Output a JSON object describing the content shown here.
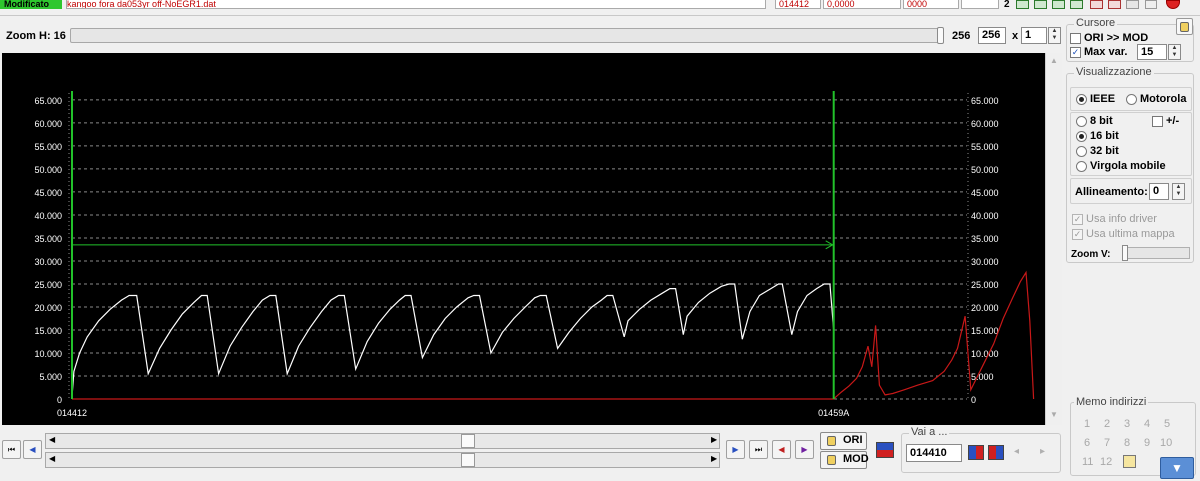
{
  "topbar": {
    "status_label": "Modificato",
    "file_name": "kangoo fora da053yr off-NoEGR1.dat",
    "address_value": "014412",
    "value_box": "0,0000",
    "hex_box": "0000",
    "counter": "2"
  },
  "zoom_h": {
    "label": "Zoom H: 16",
    "value": "256",
    "box_value": "256",
    "x_label": "x",
    "multiplier": "1"
  },
  "cursor_group": {
    "title": "Cursore",
    "ori_mod_label": "ORI >> MOD",
    "ori_mod_checked": false,
    "max_var_label": "Max var.",
    "max_var_checked": true,
    "max_var_value": "15"
  },
  "visualizzazione": {
    "title": "Visualizzazione",
    "endian_ieee": "IEEE",
    "endian_motorola": "Motorola",
    "endian_selected": "IEEE",
    "bit_8": "8 bit",
    "sign_label": "+/-",
    "bit_16": "16 bit",
    "bit_32": "32 bit",
    "float_label": "Virgola mobile",
    "bits_selected": "16 bit",
    "alignment_label": "Allineamento:",
    "alignment_value": "0",
    "use_driver_info": "Usa info driver",
    "use_last_map": "Usa ultima mappa",
    "zoom_v_label": "Zoom V:"
  },
  "memo": {
    "title": "Memo indirizzi",
    "slots": [
      "1",
      "2",
      "3",
      "4",
      "5",
      "6",
      "7",
      "8",
      "9",
      "10",
      "11",
      "12"
    ]
  },
  "bottom": {
    "ori_button": "ORI",
    "mod_button": "MOD",
    "goto_label": "Vai a ...",
    "goto_value": "014410"
  },
  "colors": {
    "chart_bg": "#000000",
    "ori_series": "#ffffff",
    "mod_series": "#c81818",
    "cursor": "#22c22a",
    "status_green": "#2ec72e"
  },
  "chart_data": {
    "type": "line",
    "y_ticks": [
      0,
      5000,
      10000,
      15000,
      20000,
      25000,
      30000,
      35000,
      40000,
      45000,
      50000,
      55000,
      60000,
      65000
    ],
    "y_tick_labels": [
      "0",
      "5.000",
      "10.000",
      "15.000",
      "20.000",
      "25.000",
      "30.000",
      "35.000",
      "40.000",
      "45.000",
      "50.000",
      "55.000",
      "60.000",
      "65.000"
    ],
    "ylim": [
      0,
      66500
    ],
    "x_labels": [
      {
        "label": "014412",
        "x": 0
      },
      {
        "label": "01459A",
        "x": 400
      }
    ],
    "xlim": [
      0,
      470
    ],
    "grid": true,
    "cursor_x": [
      0,
      400
    ],
    "cursor_arrow_y": 33500,
    "series": [
      {
        "values": [
          [
            0,
            500
          ],
          [
            1,
            6000
          ],
          [
            4,
            10000
          ],
          [
            8,
            13500
          ],
          [
            14,
            17000
          ],
          [
            20,
            19500
          ],
          [
            26,
            21500
          ],
          [
            30,
            22500
          ],
          [
            33,
            22500
          ],
          [
            34,
            22500
          ],
          [
            40,
            5500
          ],
          [
            46,
            11000
          ],
          [
            52,
            15000
          ],
          [
            58,
            18500
          ],
          [
            64,
            21000
          ],
          [
            68,
            22500
          ],
          [
            71,
            22500
          ],
          [
            77,
            5500
          ],
          [
            83,
            11500
          ],
          [
            89,
            15500
          ],
          [
            95,
            19000
          ],
          [
            100,
            21500
          ],
          [
            104,
            22500
          ],
          [
            107,
            22500
          ],
          [
            113,
            5500
          ],
          [
            119,
            11500
          ],
          [
            125,
            15500
          ],
          [
            131,
            19000
          ],
          [
            136,
            21500
          ],
          [
            140,
            22500
          ],
          [
            143,
            22500
          ],
          [
            149,
            6500
          ],
          [
            155,
            12500
          ],
          [
            161,
            16500
          ],
          [
            167,
            19500
          ],
          [
            172,
            21500
          ],
          [
            175,
            22500
          ],
          [
            178,
            22500
          ],
          [
            184,
            9000
          ],
          [
            190,
            14000
          ],
          [
            196,
            17500
          ],
          [
            202,
            20000
          ],
          [
            208,
            22000
          ],
          [
            211,
            22500
          ],
          [
            214,
            22500
          ],
          [
            220,
            10000
          ],
          [
            226,
            14500
          ],
          [
            232,
            17500
          ],
          [
            238,
            20000
          ],
          [
            243,
            22000
          ],
          [
            246,
            22500
          ],
          [
            249,
            22500
          ],
          [
            255,
            11000
          ],
          [
            261,
            14500
          ],
          [
            267,
            17500
          ],
          [
            273,
            20000
          ],
          [
            278,
            21500
          ],
          [
            281,
            22500
          ],
          [
            284,
            22500
          ],
          [
            290,
            13500
          ],
          [
            292,
            17000
          ],
          [
            298,
            19500
          ],
          [
            304,
            21500
          ],
          [
            310,
            23000
          ],
          [
            314,
            24000
          ],
          [
            317,
            24000
          ],
          [
            321,
            14000
          ],
          [
            323,
            18000
          ],
          [
            329,
            21000
          ],
          [
            335,
            23000
          ],
          [
            341,
            24500
          ],
          [
            345,
            25000
          ],
          [
            348,
            25000
          ],
          [
            352,
            13000
          ],
          [
            356,
            19000
          ],
          [
            361,
            22500
          ],
          [
            367,
            24000
          ],
          [
            371,
            25000
          ],
          [
            373,
            25000
          ],
          [
            378,
            14000
          ],
          [
            381,
            19000
          ],
          [
            386,
            22500
          ],
          [
            391,
            24000
          ],
          [
            395,
            25000
          ],
          [
            398,
            25000
          ],
          [
            400,
            15000
          ],
          [
            400,
            0
          ]
        ]
      },
      {
        "values": [
          [
            0,
            0
          ],
          [
            400,
            0
          ],
          [
            401,
            400
          ],
          [
            404,
            1500
          ],
          [
            408,
            2800
          ],
          [
            412,
            4500
          ],
          [
            415,
            7000
          ],
          [
            418,
            11500
          ],
          [
            420,
            7000
          ],
          [
            422,
            16000
          ],
          [
            424,
            3000
          ],
          [
            427,
            900
          ],
          [
            431,
            1200
          ],
          [
            437,
            2000
          ],
          [
            444,
            3000
          ],
          [
            452,
            4000
          ],
          [
            458,
            6000
          ],
          [
            462,
            8500
          ],
          [
            465,
            11000
          ],
          [
            467,
            14500
          ],
          [
            469,
            18000
          ],
          [
            472,
            2000
          ],
          [
            478,
            7000
          ],
          [
            484,
            12000
          ],
          [
            489,
            17500
          ],
          [
            494,
            22000
          ],
          [
            498,
            25500
          ],
          [
            501,
            27500
          ],
          [
            503,
            17000
          ],
          [
            505,
            0
          ]
        ]
      }
    ]
  }
}
